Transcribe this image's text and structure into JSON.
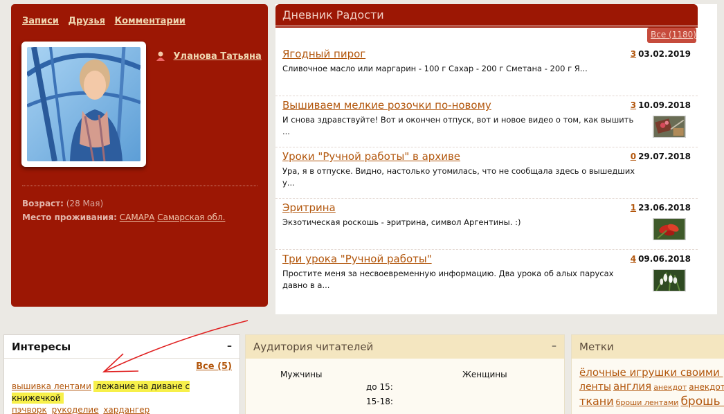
{
  "profile": {
    "nav": [
      "Записи",
      "Друзья",
      "Комментарии"
    ],
    "username": "Уланова Татьяна",
    "age_label": "Возраст:",
    "age_value": "(28 Мая)",
    "residence_label": "Место проживания:",
    "city": "САМАРА",
    "region": "Самарская обл."
  },
  "diary": {
    "title": "Дневник Радости",
    "all_label": "Все (1180)",
    "posts": [
      {
        "title": "Ягодный пирог",
        "comments": "3",
        "date": "03.02.2019",
        "excerpt": "Сливочное масло или маргарин - 100 г Сахар - 200 г Сметана - 200 г Я...",
        "thumb": "none"
      },
      {
        "title": "Вышиваем мелкие розочки по-новому",
        "comments": "3",
        "date": "10.09.2018",
        "excerpt": "И снова здравствуйте! Вот и окончен отпуск, вот и новое видео о том, как вышить ...",
        "thumb": "embroidery"
      },
      {
        "title": "Уроки \"Ручной работы\" в архиве",
        "comments": "0",
        "date": "29.07.2018",
        "excerpt": "Ура, я в отпуске. Видно, настолько утомилась, что не сообщала здесь о вышедших у...",
        "thumb": "none"
      },
      {
        "title": "Эритрина",
        "comments": "1",
        "date": "23.06.2018",
        "excerpt": "Экзотическая роскошь - эритрина, символ Аргентины. :)",
        "thumb": "red-flower"
      },
      {
        "title": "Три урока \"Ручной работы\"",
        "comments": "4",
        "date": "09.06.2018",
        "excerpt": "Простите меня за несвоевременную информацию. Два урока об алых парусах давно в а...",
        "thumb": "white-flower"
      }
    ]
  },
  "interests": {
    "title": "Интересы",
    "minimize": "–",
    "all_label": "Все (5)",
    "items": [
      "вышивка лентами",
      "лежание на диване с книжечкой",
      "пэчворк",
      "рукоделие",
      "хардангер"
    ],
    "highlighted_index": 1,
    "highlight_color": "#f7f04a"
  },
  "audience": {
    "title": "Аудитория читателей",
    "minimize": "–",
    "male_label": "Мужчины",
    "female_label": "Женщины",
    "age_rows": [
      "до 15:",
      "15-18:"
    ]
  },
  "tags": {
    "title": "Метки",
    "items": [
      {
        "text": "ёлочные игрушки своими руками",
        "size": 15
      },
      {
        "text": "ленты",
        "size": 14
      },
      {
        "text": "англия",
        "size": 15
      },
      {
        "text": "анекдот",
        "size": 11
      },
      {
        "text": "анекдот",
        "size": 12
      },
      {
        "text": "ткани",
        "size": 16
      },
      {
        "text": "броши лентами",
        "size": 11
      },
      {
        "text": "брошь из лент",
        "size": 17
      }
    ]
  },
  "theme": {
    "brand_red": "#9c1704",
    "link_color": "#b2560c",
    "annotation_color": "#e02020"
  }
}
